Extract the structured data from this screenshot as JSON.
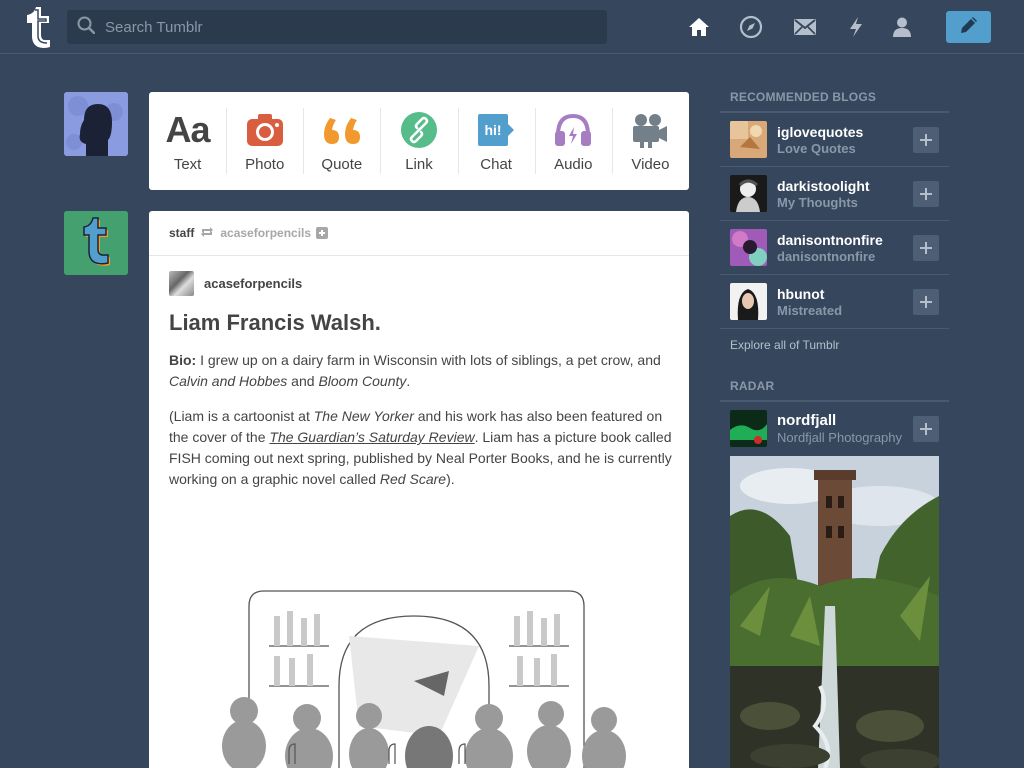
{
  "header": {
    "search_placeholder": "Search Tumblr",
    "logo": "tumblr-t-logo",
    "nav_icons": [
      "home-icon",
      "explore-icon",
      "inbox-icon",
      "activity-icon",
      "account-icon"
    ],
    "compose_icon": "pencil-icon",
    "compose_color": "#529ecc"
  },
  "post_bar": {
    "items": [
      {
        "label": "Text",
        "icon": "text-icon",
        "color": "#444444"
      },
      {
        "label": "Photo",
        "icon": "camera-icon",
        "color": "#d95e40"
      },
      {
        "label": "Quote",
        "icon": "quote-icon",
        "color": "#f2992e"
      },
      {
        "label": "Link",
        "icon": "link-icon",
        "color": "#56bc8a"
      },
      {
        "label": "Chat",
        "icon": "chat-icon",
        "color": "#529ecc"
      },
      {
        "label": "Audio",
        "icon": "headphones-icon",
        "color": "#a77dc2"
      },
      {
        "label": "Video",
        "icon": "video-camera-icon",
        "color": "#748089"
      }
    ]
  },
  "post": {
    "reblogged_by": "staff",
    "reblogged_from": "acaseforpencils",
    "source_name": "acaseforpencils",
    "title": "Liam Francis Walsh.",
    "bio_label": "Bio:",
    "bio_text_1": " I grew up on a dairy farm in Wisconsin with lots of siblings, a pet crow, and ",
    "bio_italic_1": "Calvin and Hobbes",
    "bio_text_2": " and ",
    "bio_italic_2": "Bloom County",
    "bio_text_3": ".",
    "p2_text_1": "(Liam is a cartoonist at ",
    "p2_italic_1": "The New Yorker",
    "p2_text_2": " and his work has also been featured on the cover of the ",
    "p2_link": "The Guardian’s Saturday Review",
    "p2_text_3": ". Liam has a picture book called FISH coming out next spring, published by Neal Porter Books, and he is currently working on a graphic novel called ",
    "p2_italic_2": "Red Scare",
    "p2_text_4": ")."
  },
  "sidebar": {
    "recommended_title": "RECOMMENDED BLOGS",
    "blogs": [
      {
        "name": "iglovequotes",
        "subtitle": "Love Quotes"
      },
      {
        "name": "darkistoolight",
        "subtitle": "My Thoughts"
      },
      {
        "name": "danisontnonfire",
        "subtitle": "danisontnonfire"
      },
      {
        "name": "hbunot",
        "subtitle": "Mistreated"
      }
    ],
    "explore_label": "Explore all of Tumblr",
    "radar_title": "RADAR",
    "radar": {
      "name": "nordfjall",
      "subtitle": "Nordfjall Photography"
    }
  }
}
